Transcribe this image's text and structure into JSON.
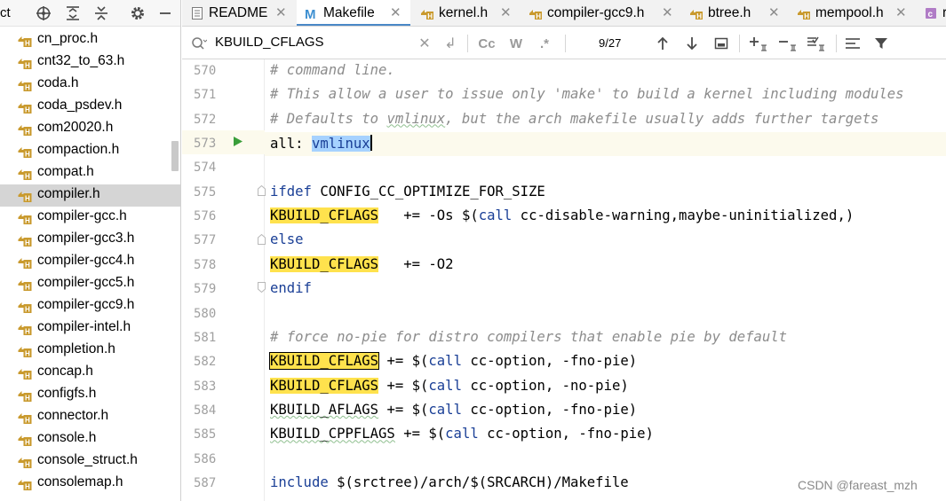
{
  "left_panel": {
    "title": "ct",
    "files": [
      {
        "name": "cn_proc.h"
      },
      {
        "name": "cnt32_to_63.h"
      },
      {
        "name": "coda.h"
      },
      {
        "name": "coda_psdev.h"
      },
      {
        "name": "com20020.h"
      },
      {
        "name": "compaction.h"
      },
      {
        "name": "compat.h"
      },
      {
        "name": "compiler.h"
      },
      {
        "name": "compiler-gcc.h"
      },
      {
        "name": "compiler-gcc3.h"
      },
      {
        "name": "compiler-gcc4.h"
      },
      {
        "name": "compiler-gcc5.h"
      },
      {
        "name": "compiler-gcc9.h"
      },
      {
        "name": "compiler-intel.h"
      },
      {
        "name": "completion.h"
      },
      {
        "name": "concap.h"
      },
      {
        "name": "configfs.h"
      },
      {
        "name": "connector.h"
      },
      {
        "name": "console.h"
      },
      {
        "name": "console_struct.h"
      },
      {
        "name": "consolemap.h"
      }
    ],
    "selected_index": 7
  },
  "tabs": [
    {
      "label": "README",
      "icon": "text-file-icon"
    },
    {
      "label": "Makefile",
      "icon": "makefile-icon",
      "active": true
    },
    {
      "label": "kernel.h",
      "icon": "header-file-icon"
    },
    {
      "label": "compiler-gcc9.h",
      "icon": "header-file-icon"
    },
    {
      "label": "btree.h",
      "icon": "header-file-icon"
    },
    {
      "label": "mempool.h",
      "icon": "header-file-icon"
    },
    {
      "label": "r",
      "icon": "c-file-icon"
    }
  ],
  "search": {
    "value": "KBUILD_CFLAGS",
    "match_case_label": "Cc",
    "words_label": "W",
    "regex_label": ".*",
    "match_count": "9/27"
  },
  "editor": {
    "lines": [
      {
        "num": "570",
        "text": "# command line."
      },
      {
        "num": "571",
        "text": "# This allow a user to issue only 'make' to build a kernel including modules"
      },
      {
        "num": "572",
        "text_a": "# Defaults to ",
        "text_b": "vmlinux",
        "text_c": ", but the arch makefile usually adds further targets"
      },
      {
        "num": "573",
        "text_a": "all: ",
        "text_b": "vmlinux"
      },
      {
        "num": "574",
        "text": ""
      },
      {
        "num": "575",
        "text": "ifdef CONFIG_CC_OPTIMIZE_FOR_SIZE"
      },
      {
        "num": "576",
        "var": "KBUILD_CFLAGS",
        "op": "   += -Os $(",
        "call": "call",
        "rest": " cc-disable-warning,maybe-uninitialized,)"
      },
      {
        "num": "577",
        "text": "else"
      },
      {
        "num": "578",
        "var": "KBUILD_CFLAGS",
        "op": "   += -O2"
      },
      {
        "num": "579",
        "text": "endif"
      },
      {
        "num": "580",
        "text": ""
      },
      {
        "num": "581",
        "text": "# force no-pie for distro compilers that enable pie by default"
      },
      {
        "num": "582",
        "var": "KBUILD_CFLAGS",
        "op": " += $(",
        "call": "call",
        "rest": " cc-option, -fno-pie)"
      },
      {
        "num": "583",
        "var": "KBUILD_CFLAGS",
        "op": " += $(",
        "call": "call",
        "rest": " cc-option, -no-pie)"
      },
      {
        "num": "584",
        "var": "KBUILD_AFLAGS",
        "op": " += $(",
        "call": "call",
        "rest": " cc-option, -fno-pie)"
      },
      {
        "num": "585",
        "var": "KBUILD_CPPFLAGS",
        "op": " += $(",
        "call": "call",
        "rest": " cc-option, -fno-pie)"
      },
      {
        "num": "586",
        "text": ""
      },
      {
        "num": "587",
        "kw": "include",
        "rest": " $(srctree)/arch/$(SRCARCH)/Makefile"
      }
    ]
  },
  "watermark": "CSDN @fareast_mzh",
  "colors": {
    "highlight": "#ffe24d",
    "selection": "#a6d2ff",
    "keyword": "#1a3f96",
    "comment": "#8c8c8c",
    "active_tab_underline": "#4a88c7"
  }
}
